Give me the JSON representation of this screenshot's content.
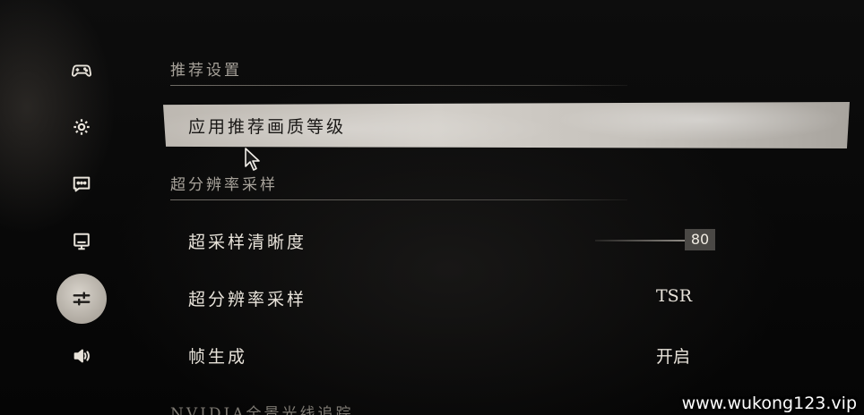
{
  "sidebar": {
    "items": [
      {
        "icon": "gamepad-icon",
        "active": false
      },
      {
        "icon": "gear-icon",
        "active": false
      },
      {
        "icon": "chat-icon",
        "active": false
      },
      {
        "icon": "monitor-icon",
        "active": false
      },
      {
        "icon": "sliders-icon",
        "active": true
      },
      {
        "icon": "speaker-icon",
        "active": false
      }
    ]
  },
  "sections": {
    "recommended": {
      "title": "推荐设置",
      "apply_label": "应用推荐画质等级"
    },
    "super_resolution": {
      "title": "超分辨率采样",
      "sharpness": {
        "label": "超采样清晰度",
        "value": "80"
      },
      "upscaling": {
        "label": "超分辨率采样",
        "value": "TSR"
      },
      "frame_gen": {
        "label": "帧生成",
        "value": "开启"
      }
    },
    "ray_tracing": {
      "title": "NVIDIA全景光线追踪"
    }
  },
  "watermark": "www.wukong123.vip",
  "colors": {
    "highlight": "#cfcbc5",
    "text": "#e8e3da",
    "background": "#050505"
  }
}
